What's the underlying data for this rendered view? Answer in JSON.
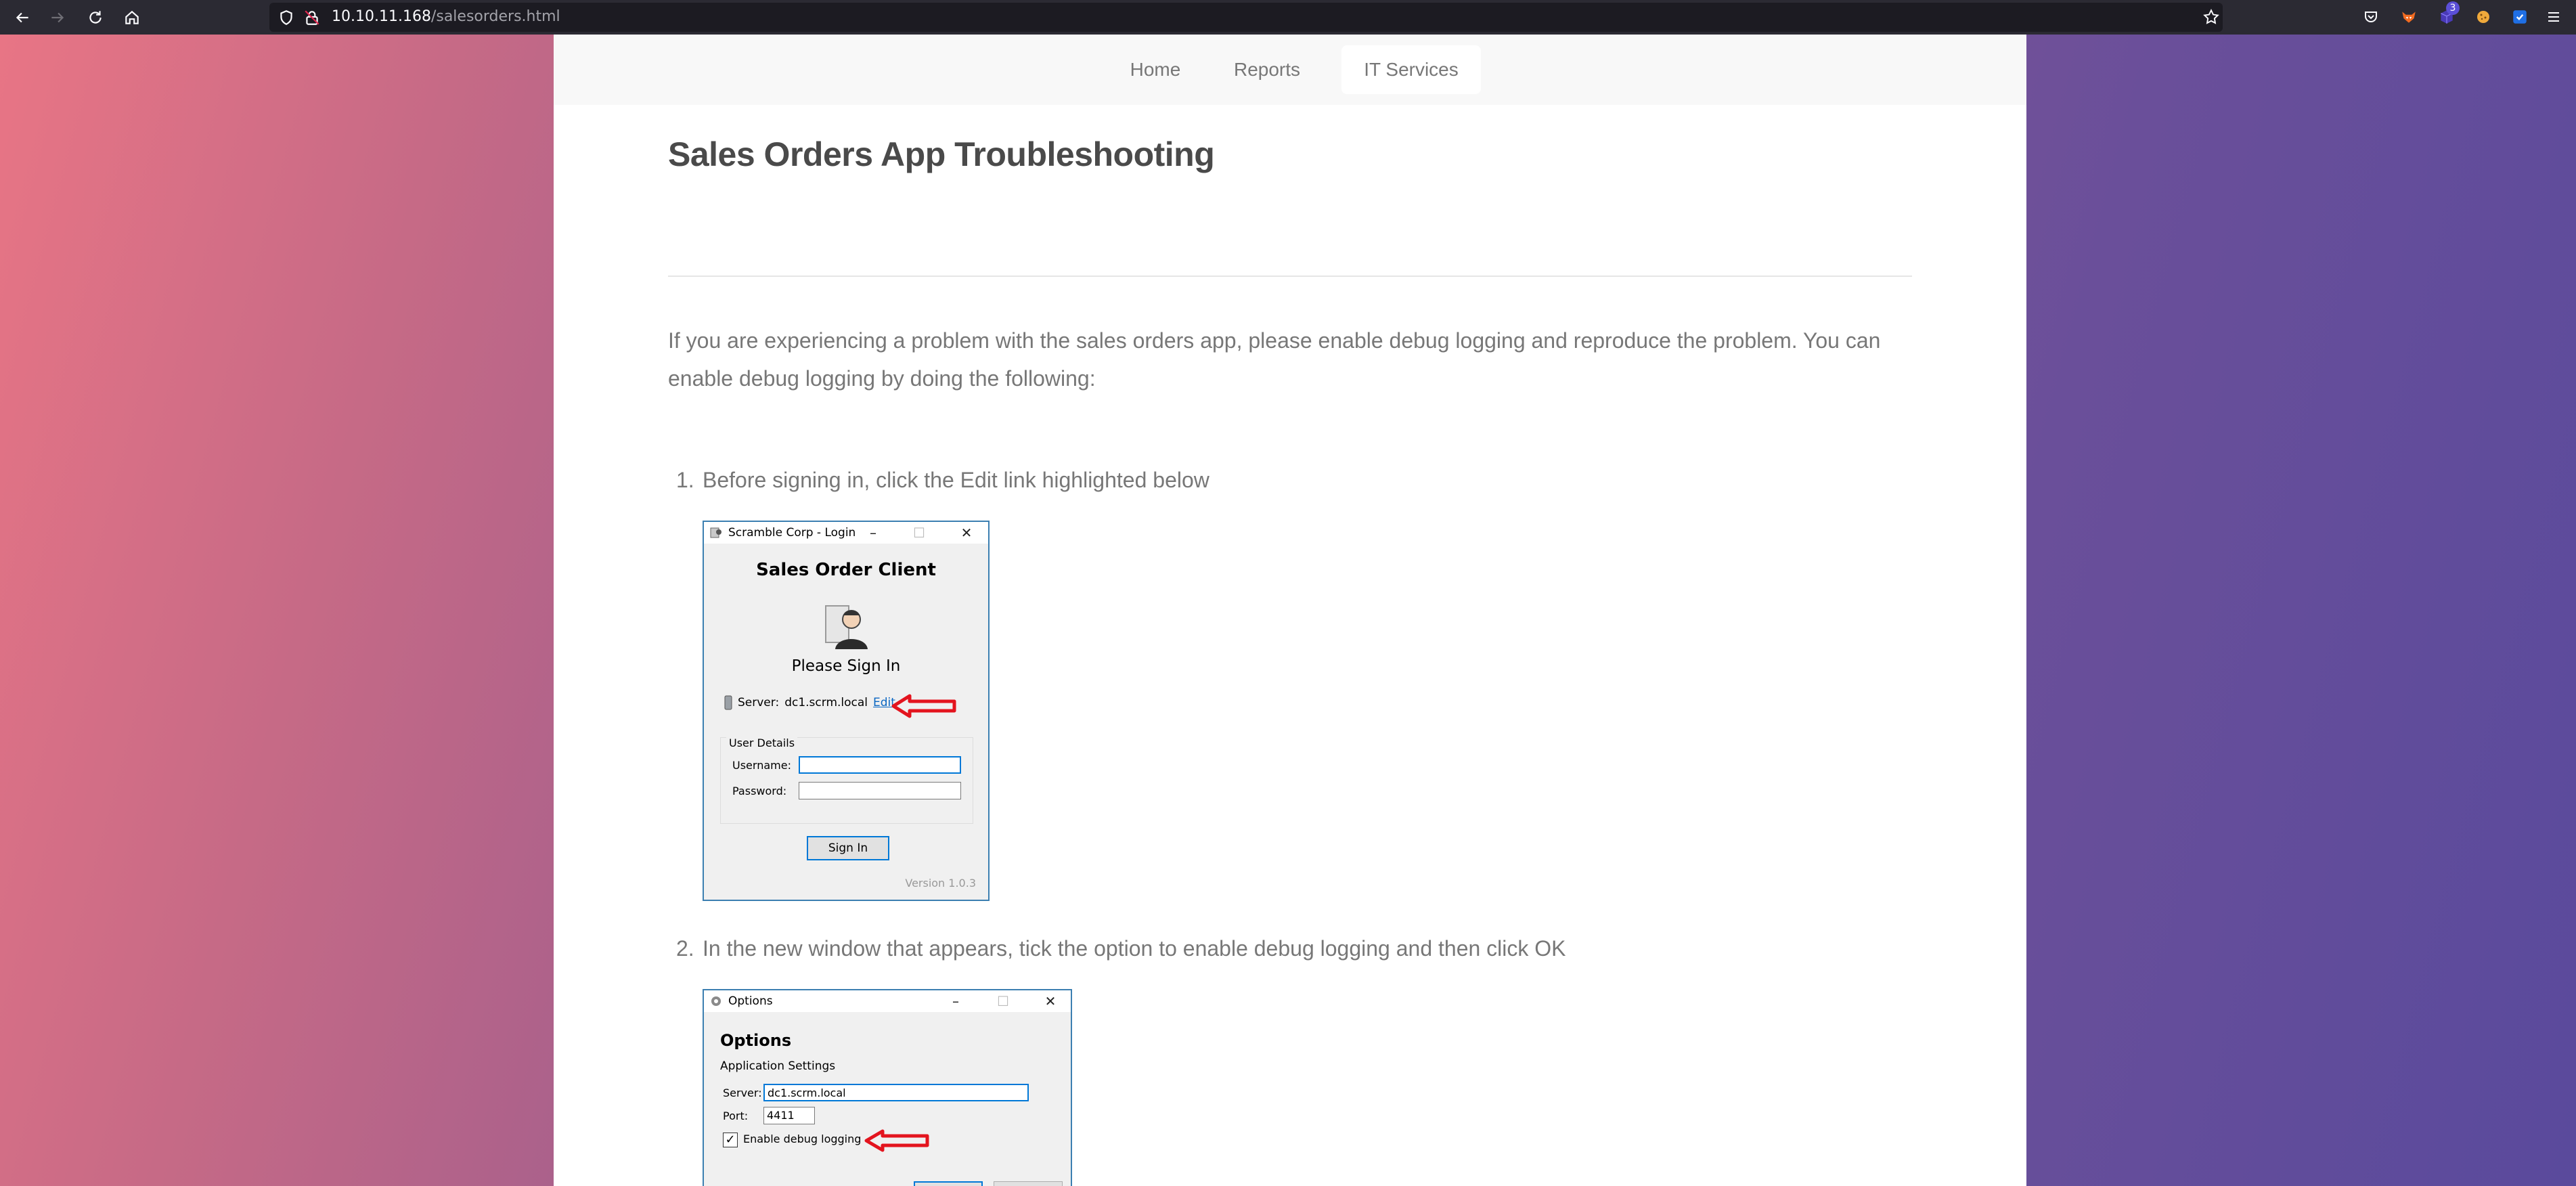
{
  "browser": {
    "url_host": "10.10.11.168",
    "url_path": "/salesorders.html",
    "icons": [
      "back-icon",
      "forward-icon",
      "reload-icon",
      "home-icon",
      "shield-icon",
      "lock-icon",
      "star-icon",
      "pocket-icon",
      "extension-fox-icon",
      "extension-cube-icon",
      "extension-cookie-icon",
      "extension-shield-icon",
      "menu-icon"
    ],
    "extension_badge": "3"
  },
  "nav": {
    "items": [
      {
        "label": "Home"
      },
      {
        "label": "Reports"
      },
      {
        "label": "IT Services",
        "active": true
      }
    ]
  },
  "page": {
    "title": "Sales Orders App Troubleshooting",
    "intro": "If you are experiencing a problem with the sales orders app, please enable debug logging and reproduce the problem. You can enable debug logging by doing the following:",
    "steps": [
      {
        "num": "1.",
        "text": "Before signing in, click the Edit link highlighted below"
      },
      {
        "num": "2.",
        "text": "In the new window that appears, tick the option to enable debug logging and then click OK"
      }
    ]
  },
  "login_dialog": {
    "window_title": "Scramble Corp - Login",
    "heading": "Sales Order Client",
    "subheading": "Please Sign In",
    "server_label": "Server:",
    "server_value": "dc1.scrm.local",
    "edit_link": "Edit",
    "group_label": "User Details",
    "username_label": "Username:",
    "username_value": "",
    "password_label": "Password:",
    "password_value": "",
    "sign_in": "Sign In",
    "version": "Version 1.0.3"
  },
  "options_dialog": {
    "window_title": "Options",
    "heading": "Options",
    "section": "Application Settings",
    "server_label": "Server:",
    "server_value": "dc1.scrm.local",
    "port_label": "Port:",
    "port_value": "4411",
    "debug_label": "Enable debug logging",
    "debug_checked": true
  },
  "colors": {
    "highlight_arrow": "#e3141e",
    "bg_gradient_left": "#e87585",
    "bg_gradient_right": "#5a4a9c"
  }
}
